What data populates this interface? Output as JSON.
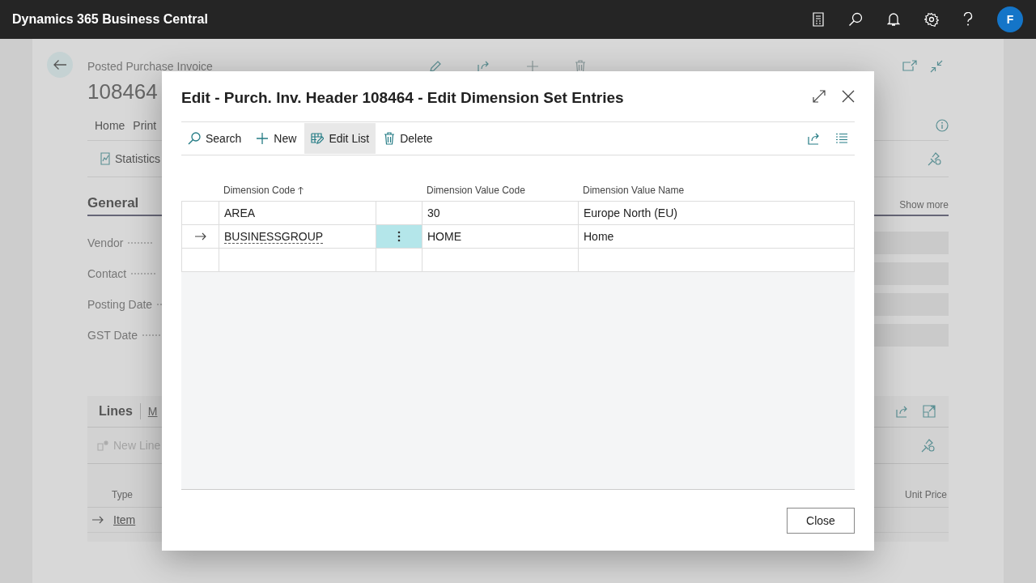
{
  "app_bar": {
    "title": "Dynamics 365 Business Central",
    "avatar": "F"
  },
  "page": {
    "caption": "Posted Purchase Invoice",
    "number": "108464",
    "tabs": [
      {
        "label": "Home"
      },
      {
        "label": "Print"
      }
    ],
    "actions": [
      {
        "label": "Statistics"
      }
    ],
    "general": {
      "title": "General",
      "show_more": "Show more",
      "fields": [
        {
          "label": "Vendor"
        },
        {
          "label": "Contact"
        },
        {
          "label": "Posting Date"
        },
        {
          "label": "GST Date"
        }
      ]
    },
    "lines": {
      "title": "Lines",
      "tabs": [
        "M"
      ],
      "new_line": {
        "label": "New Line",
        "disabled": true
      },
      "columns": [
        "Type",
        "Unit Price"
      ],
      "rows": [
        {
          "type": "Item",
          "current": true
        }
      ]
    }
  },
  "modal": {
    "title": "Edit - Purch. Inv. Header 108464 - Edit Dimension Set Entries",
    "actions": [
      {
        "label": "Search",
        "selected": false
      },
      {
        "label": "New",
        "selected": false
      },
      {
        "label": "Edit List",
        "selected": true
      },
      {
        "label": "Delete",
        "selected": false
      }
    ],
    "columns": [
      {
        "label": "Dimension Code",
        "sorted": true
      },
      {
        "label": "Dimension Value Code",
        "sorted": false
      },
      {
        "label": "Dimension Value Name",
        "sorted": false
      }
    ],
    "rows": [
      {
        "dimension_code": "AREA",
        "value_code": "30",
        "value_name": "Europe North (EU)",
        "current": false
      },
      {
        "dimension_code": "BUSINESSGROUP",
        "value_code": "HOME",
        "value_name": "Home",
        "current": true
      }
    ],
    "close_button": "Close"
  }
}
